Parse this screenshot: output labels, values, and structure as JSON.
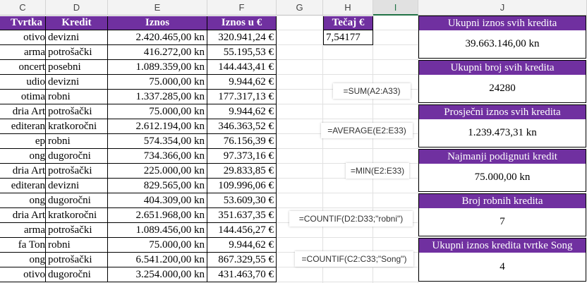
{
  "columns": [
    "C",
    "D",
    "E",
    "F",
    "G",
    "H",
    "I",
    "J"
  ],
  "table": {
    "headers": [
      "Tvrtka",
      "Kredit",
      "Iznos",
      "Iznos u €"
    ],
    "rows": [
      [
        "otivo",
        "devizni",
        "2.420.465,00 kn",
        "320.941,24 €"
      ],
      [
        "arma",
        "potrošački",
        "416.272,00 kn",
        "55.195,53 €"
      ],
      [
        "oncert",
        "posebni",
        "1.089.359,00 kn",
        "144.443,41 €"
      ],
      [
        "udio",
        "devizni",
        "75.000,00 kn",
        "9.944,62 €"
      ],
      [
        "otima",
        "robni",
        "1.337.285,00 kn",
        "177.317,13 €"
      ],
      [
        "dria Art",
        "potrošački",
        "75.000,00 kn",
        "9.944,62 €"
      ],
      [
        "editeran",
        "kratkoročni",
        "2.612.194,00 kn",
        "346.363,52 €"
      ],
      [
        "ep",
        "robni",
        "574.354,00 kn",
        "76.156,39 €"
      ],
      [
        "ong",
        "dugoročni",
        "734.366,00 kn",
        "97.373,16 €"
      ],
      [
        "dria Art",
        "potrošački",
        "225.000,00 kn",
        "29.833,85 €"
      ],
      [
        "editeran",
        "devizni",
        "829.565,00 kn",
        "109.996,06 €"
      ],
      [
        "ong",
        "dugoročni",
        "404.309,00 kn",
        "53.609,30 €"
      ],
      [
        "dria Art",
        "kratkoročni",
        "2.651.968,00 kn",
        "351.637,35 €"
      ],
      [
        "arma",
        "potrošački",
        "1.089.456,00 kn",
        "144.456,27 €"
      ],
      [
        "fa Ton",
        "robni",
        "75.000,00 kn",
        "9.944,62 €"
      ],
      [
        "ong",
        "potrošački",
        "6.541.200,00 kn",
        "867.329,55 €"
      ],
      [
        "otivo",
        "dugoročni",
        "3.254.000,00 kn",
        "431.463,70 €"
      ]
    ]
  },
  "rate": {
    "label": "Tečaj €",
    "value": "7,54177"
  },
  "summary": [
    {
      "title": "Ukupni iznos svih kredita",
      "value": "39.663.146,00 kn"
    },
    {
      "title": "Ukupni broj svih kredita",
      "value": "24280"
    },
    {
      "title": "Prosječni iznos svih kredita",
      "value": "1.239.473,31 kn"
    },
    {
      "title": "Najmanji podignuti kredit",
      "value": "75.000,00 kn"
    },
    {
      "title": "Broj robnih kredita",
      "value": "7"
    },
    {
      "title": "Ukupni iznos kredita tvrtke Song",
      "value": "4"
    }
  ],
  "formulas": [
    "=SUM(A2:A33)",
    "=AVERAGE(E2:E33)",
    "=MIN(E2:E33)",
    "=COUNTIF(D2:D33;\"robni\")",
    "=COUNTIF(C2:C33;\"Song\")"
  ]
}
